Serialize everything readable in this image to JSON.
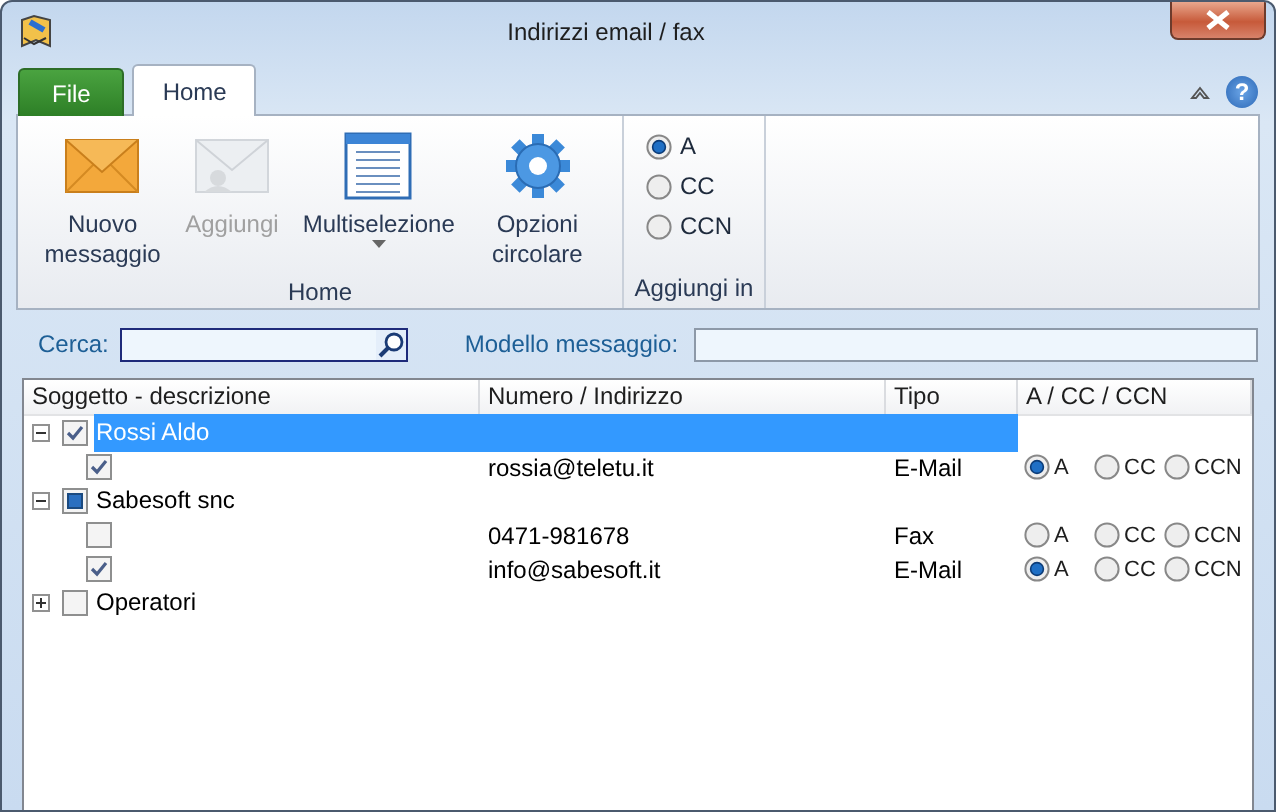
{
  "window": {
    "title": "Indirizzi email / fax",
    "help_button": "?"
  },
  "tabs": [
    {
      "label": "File",
      "kind": "file",
      "selected": false
    },
    {
      "label": "Home",
      "kind": "normal",
      "selected": true
    }
  ],
  "ribbon": {
    "groups": [
      {
        "label": "Home",
        "kind": "buttons",
        "buttons": [
          {
            "label": "Nuovo messaggio",
            "kind": "new",
            "disabled": false,
            "dropdown": false
          },
          {
            "label": "Aggiungi",
            "kind": "add",
            "disabled": true,
            "dropdown": false
          },
          {
            "label": "Multiselezione",
            "kind": "multi",
            "disabled": false,
            "dropdown": true
          },
          {
            "label": "Opzioni circolare",
            "kind": "options",
            "disabled": false,
            "dropdown": false
          }
        ]
      },
      {
        "label": "Aggiungi in",
        "kind": "radios",
        "options": [
          {
            "label": "A",
            "selected": true
          },
          {
            "label": "CC",
            "selected": false
          },
          {
            "label": "CCN",
            "selected": false
          }
        ]
      }
    ]
  },
  "search": {
    "label": "Cerca:"
  },
  "template": {
    "label": "Modello messaggio:"
  },
  "table": {
    "columns": [
      "Soggetto - descrizione",
      "Numero / Indirizzo",
      "Tipo",
      "A / CC / CCN"
    ],
    "rows": [
      {
        "name": "Rossi Aldo",
        "expanded": true,
        "checked": true,
        "partial": false,
        "selected": true,
        "children": [
          {
            "checked": true,
            "address": "rossia@teletu.it",
            "type": "E-Mail",
            "send_as": [
              {
                "label": "A",
                "selected": true
              },
              {
                "label": "CC",
                "selected": false
              },
              {
                "label": "CCN",
                "selected": false
              }
            ]
          }
        ]
      },
      {
        "name": "Sabesoft snc",
        "expanded": true,
        "checked": false,
        "partial": true,
        "selected": false,
        "children": [
          {
            "checked": false,
            "address": "0471-981678",
            "type": "Fax",
            "send_as": [
              {
                "label": "A",
                "selected": false
              },
              {
                "label": "CC",
                "selected": false
              },
              {
                "label": "CCN",
                "selected": false
              }
            ]
          },
          {
            "checked": true,
            "address": "info@sabesoft.it",
            "type": "E-Mail",
            "send_as": [
              {
                "label": "A",
                "selected": true
              },
              {
                "label": "CC",
                "selected": false
              },
              {
                "label": "CCN",
                "selected": false
              }
            ]
          }
        ]
      },
      {
        "name": "Operatori",
        "expanded": false,
        "checked": false,
        "partial": false,
        "selected": false
      }
    ]
  }
}
